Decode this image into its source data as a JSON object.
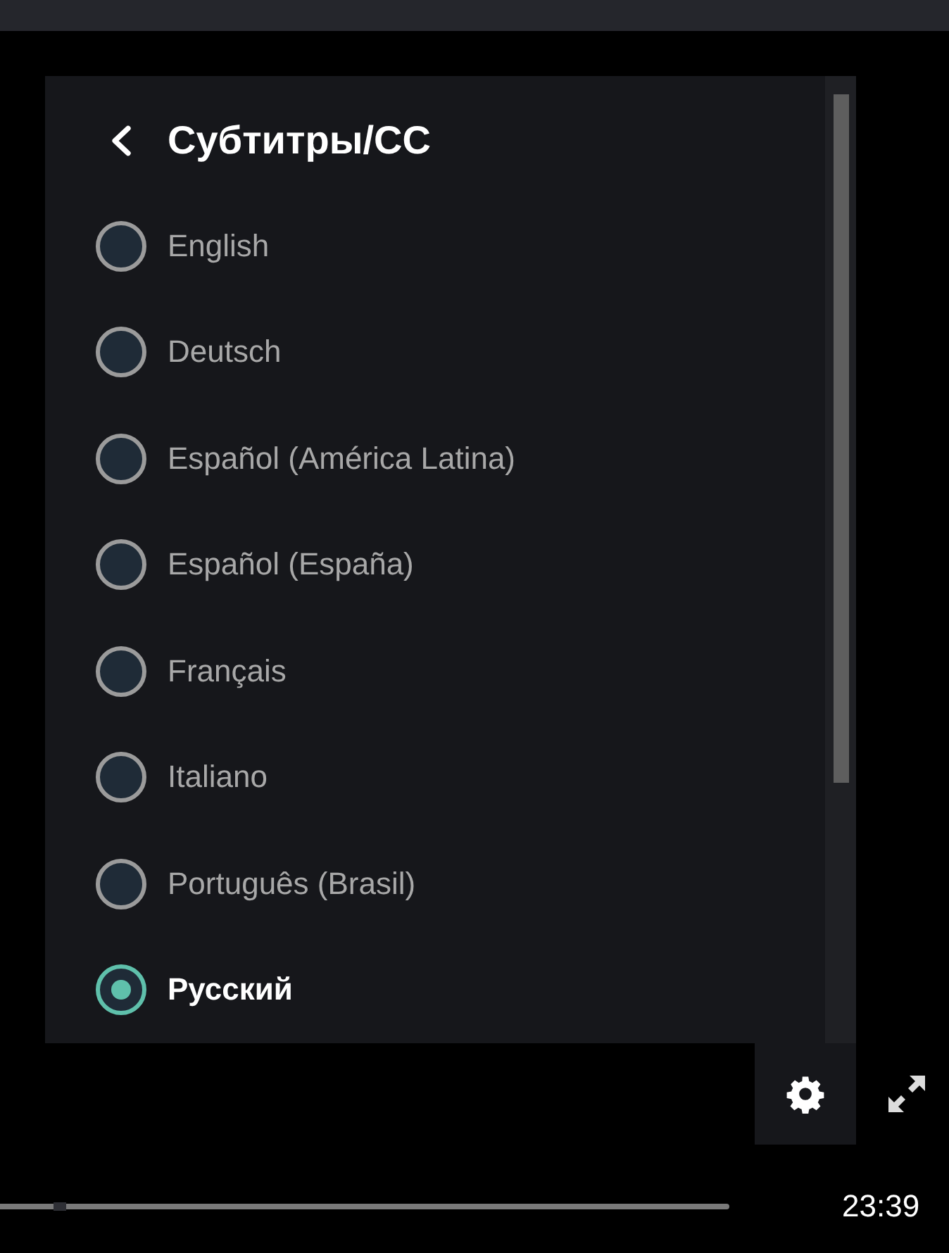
{
  "menu": {
    "title": "Субтитры/CC"
  },
  "options": [
    {
      "label": "English",
      "selected": false
    },
    {
      "label": "Deutsch",
      "selected": false
    },
    {
      "label": "Español (América Latina)",
      "selected": false
    },
    {
      "label": "Español (España)",
      "selected": false
    },
    {
      "label": "Français",
      "selected": false
    },
    {
      "label": "Italiano",
      "selected": false
    },
    {
      "label": "Português (Brasil)",
      "selected": false
    },
    {
      "label": "Русский",
      "selected": true
    }
  ],
  "settings_button": {
    "active": true
  },
  "progress": {
    "level": 0.083
  },
  "time": "23:39"
}
